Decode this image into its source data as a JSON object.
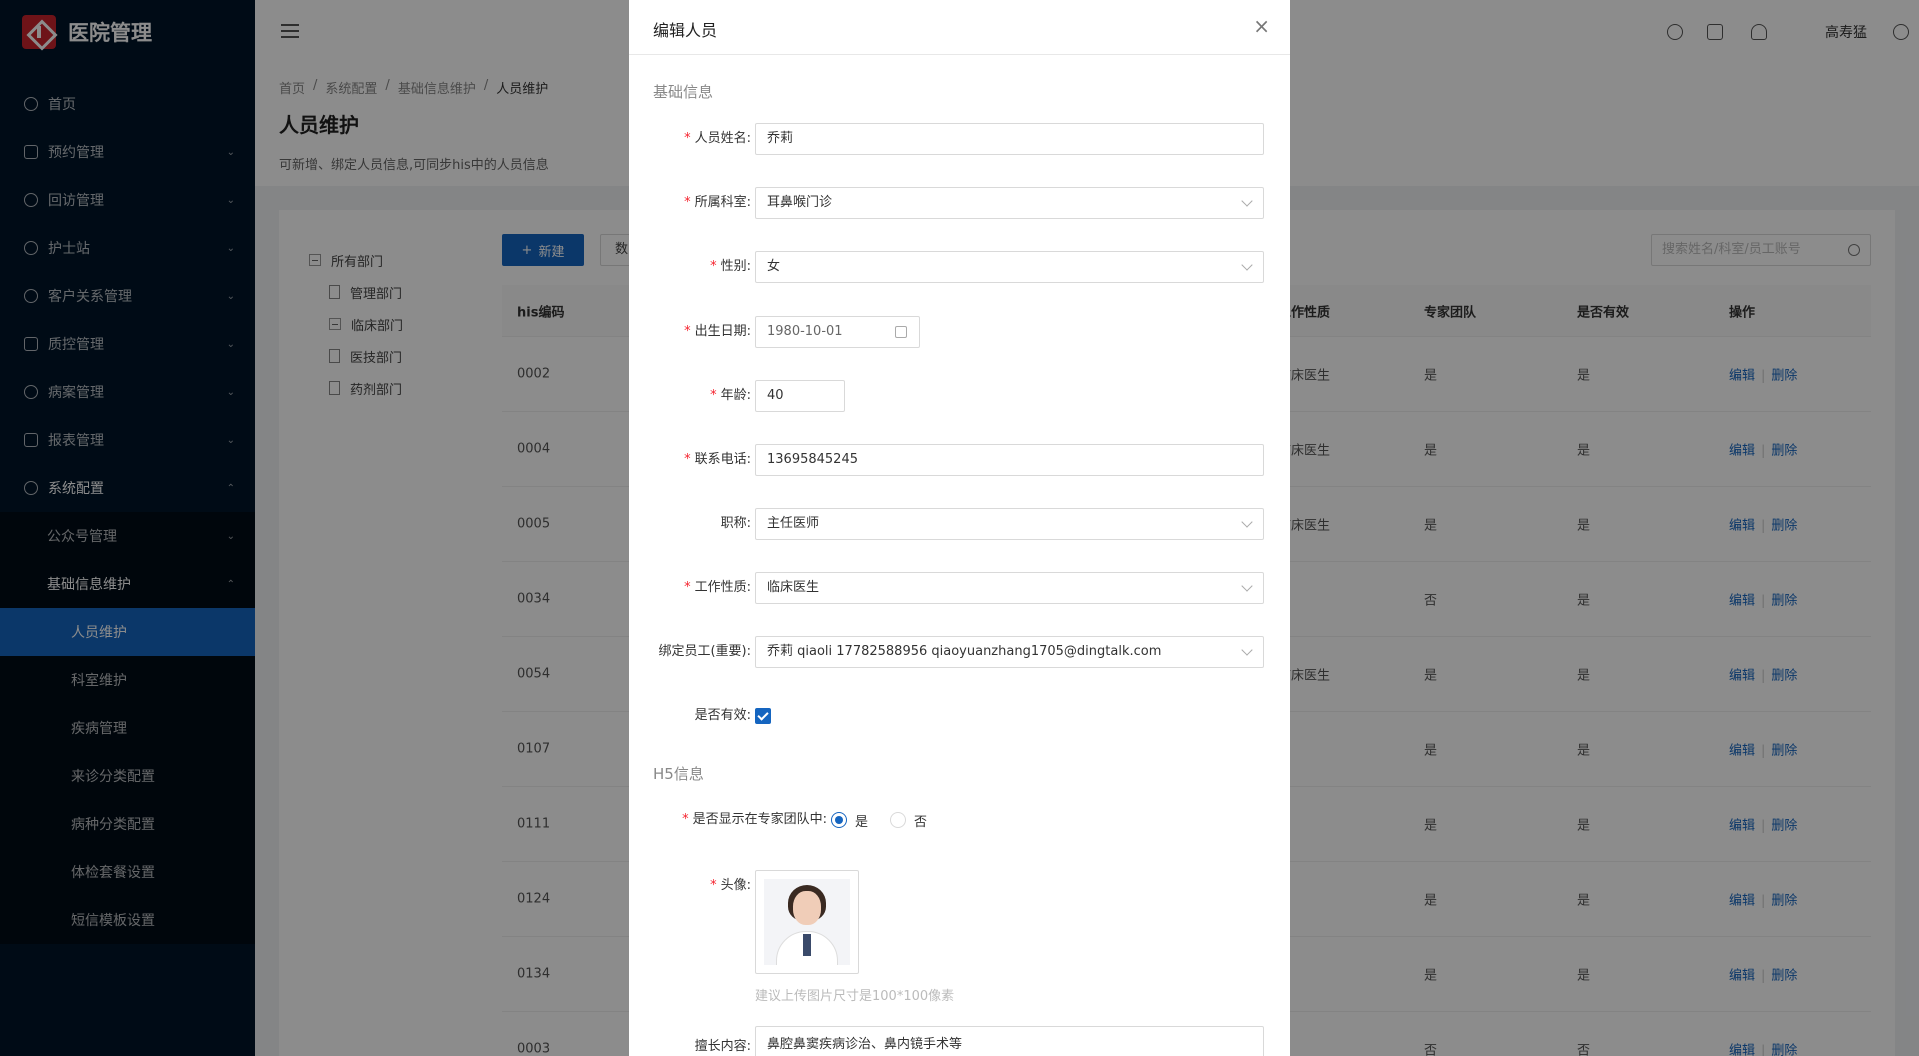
{
  "app": {
    "title": "医院管理"
  },
  "sidebar": {
    "items": [
      {
        "label": "首页"
      },
      {
        "label": "预约管理"
      },
      {
        "label": "回访管理"
      },
      {
        "label": "护士站"
      },
      {
        "label": "客户关系管理"
      },
      {
        "label": "质控管理"
      },
      {
        "label": "病案管理"
      },
      {
        "label": "报表管理"
      },
      {
        "label": "系统配置"
      }
    ],
    "system_sub": [
      {
        "label": "公众号管理"
      },
      {
        "label": "基础信息维护"
      }
    ],
    "basic_sub": [
      {
        "label": "人员维护"
      },
      {
        "label": "科室维护"
      },
      {
        "label": "疾病管理"
      },
      {
        "label": "来诊分类配置"
      },
      {
        "label": "病种分类配置"
      },
      {
        "label": "体检套餐设置"
      },
      {
        "label": "短信模板设置"
      }
    ]
  },
  "header": {
    "user": "高寿猛"
  },
  "page": {
    "breadcrumb": [
      "首页",
      "系统配置",
      "基础信息维护",
      "人员维护"
    ],
    "title": "人员维护",
    "desc": "可新增、绑定人员信息,可同步his中的人员信息"
  },
  "tree": {
    "root": "所有部门",
    "children": [
      "管理部门",
      "临床部门",
      "医技部门",
      "药剂部门"
    ]
  },
  "toolbar": {
    "new_label": "新建",
    "second_label": "数",
    "search_placeholder": "搜索姓名/科室/员工账号"
  },
  "table": {
    "headers": {
      "code": "his编码",
      "work": "工作性质",
      "team": "专家团队",
      "valid": "是否有效",
      "op": "操作"
    },
    "edit_label": "编辑",
    "delete_label": "删除",
    "rows": [
      {
        "code": "0002",
        "work": "临床医生",
        "team": "是",
        "valid": "是"
      },
      {
        "code": "0004",
        "work": "临床医生",
        "team": "是",
        "valid": "是"
      },
      {
        "code": "0005",
        "work": "临床医生",
        "team": "是",
        "valid": "是"
      },
      {
        "code": "0034",
        "work": "",
        "team": "否",
        "valid": "是"
      },
      {
        "code": "0054",
        "work": "临床医生",
        "team": "是",
        "valid": "是"
      },
      {
        "code": "0107",
        "work": "",
        "team": "是",
        "valid": "是"
      },
      {
        "code": "0111",
        "work": "",
        "team": "是",
        "valid": "是"
      },
      {
        "code": "0124",
        "work": "",
        "team": "是",
        "valid": "是"
      },
      {
        "code": "0134",
        "work": "",
        "team": "是",
        "valid": "是"
      },
      {
        "code": "0003",
        "work": "",
        "team": "否",
        "valid": "否"
      }
    ]
  },
  "modal": {
    "title": "编辑人员",
    "section_basic": "基础信息",
    "section_h5": "H5信息",
    "fields": {
      "name": {
        "label": "人员姓名:",
        "value": "乔莉"
      },
      "dept": {
        "label": "所属科室:",
        "value": "耳鼻喉门诊"
      },
      "gender": {
        "label": "性别:",
        "value": "女"
      },
      "birth": {
        "label": "出生日期:",
        "value": "1980-10-01"
      },
      "age": {
        "label": "年龄:",
        "value": "40"
      },
      "phone": {
        "label": "联系电话:",
        "value": "13695845245"
      },
      "title": {
        "label": "职称:",
        "value": "主任医师"
      },
      "work": {
        "label": "工作性质:",
        "value": "临床医生"
      },
      "bind": {
        "label": "绑定员工(重要):",
        "value": "乔莉 qiaoli 17782588956 qiaoyuanzhang1705@dingtalk.com"
      },
      "valid": {
        "label": "是否有效:"
      },
      "show_team": {
        "label": "是否显示在专家团队中:",
        "yes": "是",
        "no": "否"
      },
      "avatar": {
        "label": "头像:",
        "tip": "建议上传图片尺寸是100*100像素"
      },
      "specialty": {
        "label": "擅长内容:",
        "value": "鼻腔鼻窦疾病诊治、鼻内镜手术等"
      }
    }
  }
}
